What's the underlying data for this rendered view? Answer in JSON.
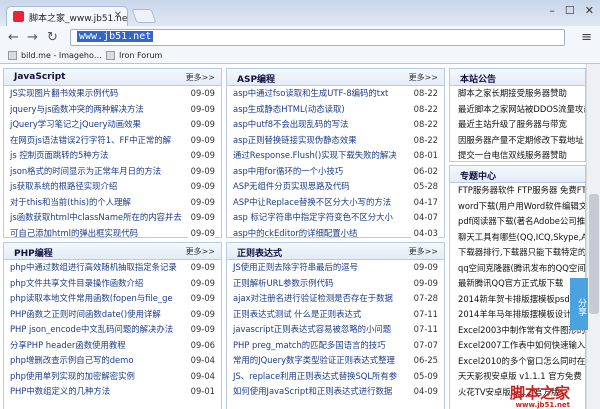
{
  "browser": {
    "tab_title": "脚本之家_www.jb51.net",
    "url": "www.jb51.net",
    "bookmarks": [
      "bild.me - Imageho…",
      "Iron Forum"
    ]
  },
  "sections": {
    "javascript": {
      "title": "JavaScript",
      "more": "更多>>",
      "items": [
        {
          "t": "JS实现图片翻书效果示例代码",
          "d": "09-09"
        },
        {
          "t": "jquery与js函数冲突的两种解决方法",
          "d": "09-09"
        },
        {
          "t": "jQuery学习笔记之jQuery动画效果",
          "d": "09-09"
        },
        {
          "t": "在网页js语法错误2行字符1、FF中正常的解",
          "d": "09-09"
        },
        {
          "t": "js 控制页面跳转的5种方法",
          "d": "09-09"
        },
        {
          "t": "json格式的时间显示为正常年月日的方法",
          "d": "09-09"
        },
        {
          "t": "js获取系统的根路径实现介绍",
          "d": "09-09"
        },
        {
          "t": "对于this和当前(this)的个人理解",
          "d": "09-09"
        },
        {
          "t": "js函数获取html中className所在的内容并去",
          "d": "09-09"
        },
        {
          "t": "可自己添加html的弹出框实现代码",
          "d": "09-09"
        }
      ]
    },
    "asp": {
      "title": "ASP编程",
      "more": "更多>>",
      "items": [
        {
          "t": "asp中通过fso读取和生成UTF-8编码的txt",
          "d": "08-22"
        },
        {
          "t": "asp生成静态HTML(动态读取)",
          "d": "08-22"
        },
        {
          "t": "asp中utf8不会出现乱码的写法",
          "d": "08-22"
        },
        {
          "t": "asp正则替换链接实现伪静态效果",
          "d": "08-22"
        },
        {
          "t": "通过Response.Flush()实现下载失败的解决",
          "d": "08-01"
        },
        {
          "t": "asp中用for循环的一个小技巧",
          "d": "06-02"
        },
        {
          "t": "ASP无组件分页实现思路及代码",
          "d": "05-28"
        },
        {
          "t": "ASP中让Replace替换不区分大小写的方法",
          "d": "04-17"
        },
        {
          "t": "asp 标记字符串中指定字符变色不区分大小",
          "d": "04-07"
        },
        {
          "t": "asp中的ckEditor的详细配置小结",
          "d": "04-03"
        }
      ]
    },
    "php": {
      "title": "PHP编程",
      "more": "更多>>",
      "items": [
        {
          "t": "php中通过数组进行高效随机抽取指定条记录",
          "d": "09-09"
        },
        {
          "t": "php文件共享文件目录操作函数介绍",
          "d": "09-09"
        },
        {
          "t": "php读取本地文件常用函数(fopen与file_ge",
          "d": "09-09"
        },
        {
          "t": "PHP函数之正则时间函数date()使用详解",
          "d": "09-09"
        },
        {
          "t": "PHP json_encode中文乱码问题的解决办法",
          "d": "09-09"
        },
        {
          "t": "分享PHP header函数使用教程",
          "d": "09-06"
        },
        {
          "t": "php增删改查示例自己写的demo",
          "d": "09-04"
        },
        {
          "t": "php使用单列实现的加密解密实例",
          "d": "09-04"
        },
        {
          "t": "PHP中数组定义的几种方法",
          "d": "09-01"
        }
      ]
    },
    "regex": {
      "title": "正则表达式",
      "more": "更多>>",
      "items": [
        {
          "t": "JS使用正则去除字符串最后的逗号",
          "d": "09-09"
        },
        {
          "t": "正则解析URL参数示例代码",
          "d": "09-09"
        },
        {
          "t": "ajax对注册名进行验证检测是否存在于数据",
          "d": "07-28"
        },
        {
          "t": "正则表达式测试 什么是正则表达式",
          "d": "07-11"
        },
        {
          "t": "javascript正则表达式容易被忽略的小问题",
          "d": "07-11"
        },
        {
          "t": "PHP preg_match的匹配多国语言的技巧",
          "d": "07-07"
        },
        {
          "t": "常用的JQuery数字类型验证正则表达式整理",
          "d": "06-25"
        },
        {
          "t": "JS、replace利用正则表达式替换SQL所有参",
          "d": "05-09"
        },
        {
          "t": "如何使用JavaScript和正则表达式进行数据",
          "d": "04-09"
        }
      ]
    },
    "notice": {
      "title": "本站公告",
      "items": [
        "脚本之家长期接受服务器赞助",
        "最近脚本之家网站被DDOS流量攻击",
        "最近主站升级了服务器与带宽",
        "因服务器产量不定期修改下载地址",
        "提交一台电信双线服务器赞助"
      ]
    },
    "topics": {
      "title": "专题中心",
      "items": [
        "FTP服务器软件 FTP服务器 免费FTP",
        "word下载(用户用Word软件编辑文档",
        "pdf阅读器下载(著名Adobe公司推",
        "聊天工具有哪些(QQ,ICQ,Skype,Aol",
        "下载器排行,下载器只能下载特定的文",
        "qq空间克隆器(腾讯发布的QQ空间",
        "最新腾讯QQ官方正式版下载",
        "2014新年贺卡排版摆模板psd设计",
        "2014羊年马年排版摆模板设计",
        "Excel2003中制作常有文件图形的方",
        "Excel2007工作表中如何快速输入带",
        "Excel2010的多个窗口怎么同时在一",
        "天天影视安卓版 v1.1.1 官方免费",
        "火花TV安卓版 v1.2 官方版"
      ]
    }
  },
  "share_label": "分享",
  "watermark": {
    "text": "脚本之家",
    "url": "www.jb51.net"
  }
}
